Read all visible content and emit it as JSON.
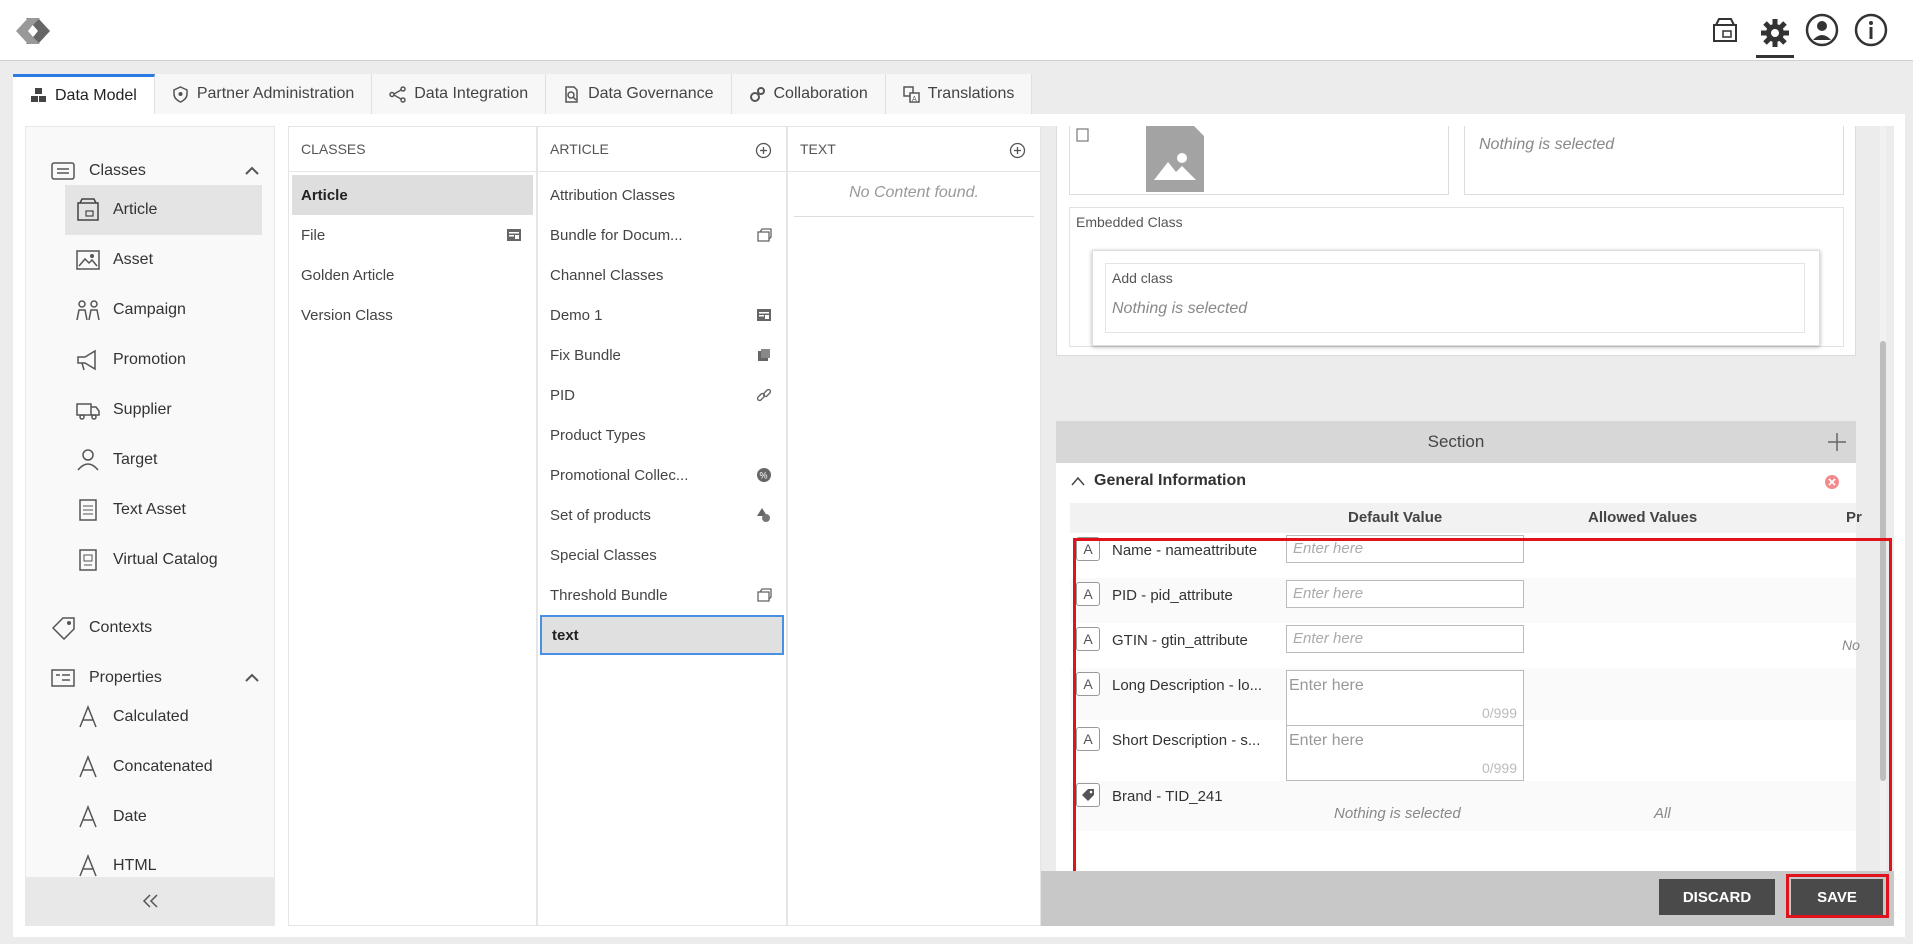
{
  "topbar": {
    "icons": [
      "package-icon",
      "gear-icon",
      "user-icon",
      "info-icon"
    ]
  },
  "tabs": [
    {
      "label": "Data Model",
      "icon": "cubes-icon"
    },
    {
      "label": "Partner Administration",
      "icon": "shield-icon"
    },
    {
      "label": "Data Integration",
      "icon": "share-icon"
    },
    {
      "label": "Data Governance",
      "icon": "doc-search-icon"
    },
    {
      "label": "Collaboration",
      "icon": "gears-icon"
    },
    {
      "label": "Translations",
      "icon": "translate-icon"
    }
  ],
  "sidebar": {
    "groups": [
      {
        "label": "Classes"
      },
      {
        "label": "Contexts"
      },
      {
        "label": "Properties"
      }
    ],
    "class_items": [
      "Article",
      "Asset",
      "Campaign",
      "Promotion",
      "Supplier",
      "Target",
      "Text Asset",
      "Virtual Catalog"
    ],
    "property_items": [
      "Calculated",
      "Concatenated",
      "Date",
      "HTML"
    ]
  },
  "classes_col": {
    "header": "CLASSES",
    "items": [
      "Article",
      "File",
      "Golden Article",
      "Version Class"
    ]
  },
  "article_col": {
    "header": "ARTICLE",
    "items": [
      "Attribution Classes",
      "Bundle for Docum...",
      "Channel Classes",
      "Demo 1",
      "Fix Bundle",
      "PID",
      "Product Types",
      "Promotional Collec...",
      "Set of products",
      "Special Classes",
      "Threshold Bundle",
      "text"
    ]
  },
  "text_col": {
    "header": "TEXT",
    "empty": "No Content found."
  },
  "detail": {
    "nothing_selected": "Nothing is selected",
    "embedded_class": "Embedded Class",
    "add_class": "Add class",
    "section": "Section",
    "general_information": "General Information",
    "col_default": "Default Value",
    "col_allowed": "Allowed Values",
    "col_pr": "Pr",
    "placeholder": "Enter here",
    "counter": "0/999",
    "truncated_no": "No",
    "all": "All",
    "attributes": [
      "Name - nameattribute",
      "PID - pid_attribute",
      "GTIN - gtin_attribute",
      "Long Description - lo...",
      "Short Description - s...",
      "Brand - TID_241"
    ]
  },
  "footer": {
    "discard": "DISCARD",
    "save": "SAVE"
  },
  "colors": {
    "accent_blue": "#2c7be5",
    "highlight_red": "#e0121b",
    "button_dark": "#4a4a4a"
  }
}
